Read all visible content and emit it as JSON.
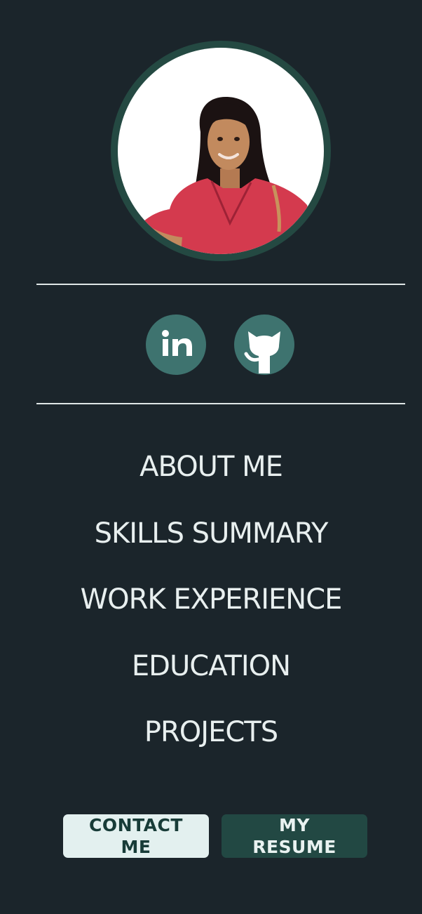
{
  "profile": {
    "photo_alt": "profile-photo"
  },
  "social": {
    "linkedin_icon": "linkedin-icon",
    "github_icon": "github-icon",
    "linkedin_label": "in"
  },
  "nav": {
    "items": [
      {
        "label": "ABOUT ME"
      },
      {
        "label": "SKILLS SUMMARY"
      },
      {
        "label": "WORK EXPERIENCE"
      },
      {
        "label": "EDUCATION"
      },
      {
        "label": "PROJECTS"
      }
    ]
  },
  "actions": {
    "contact_label": "CONTACT ME",
    "resume_label": "MY RESUME"
  },
  "colors": {
    "background": "#1b252b",
    "accent": "#3e736f",
    "frame": "#244942",
    "button_light": "#e3f0ef",
    "button_dark": "#224843"
  }
}
